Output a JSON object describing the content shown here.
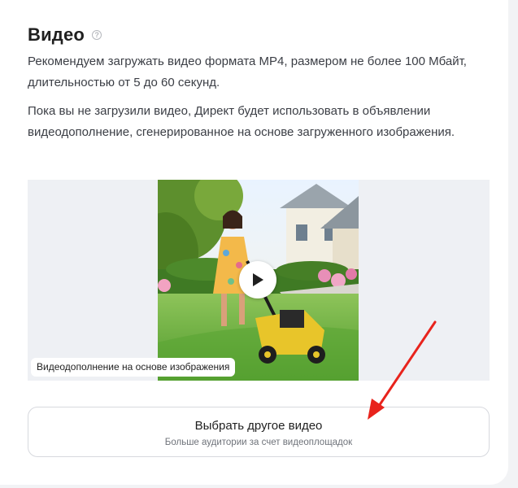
{
  "section": {
    "title": "Видео",
    "help_icon": "question-circle-icon",
    "description_1": "Рекомендуем загружать видео формата MP4, размером не более 100 Мбайт, длительностью от 5 до 60 секунд.",
    "description_2": "Пока вы не загрузили видео, Директ будет использовать в объявлении видеодополнение, сгенерированное на основе загруженного изображения."
  },
  "preview": {
    "caption": "Видеодополнение на основе изображения",
    "play_icon": "play-icon"
  },
  "choose_button": {
    "label": "Выбрать другое видео",
    "sublabel": "Больше аудитории за счет видеоплощадок"
  },
  "colors": {
    "annotation_arrow": "#e8231c",
    "card_background": "#ffffff",
    "page_background": "#f2f3f5"
  }
}
